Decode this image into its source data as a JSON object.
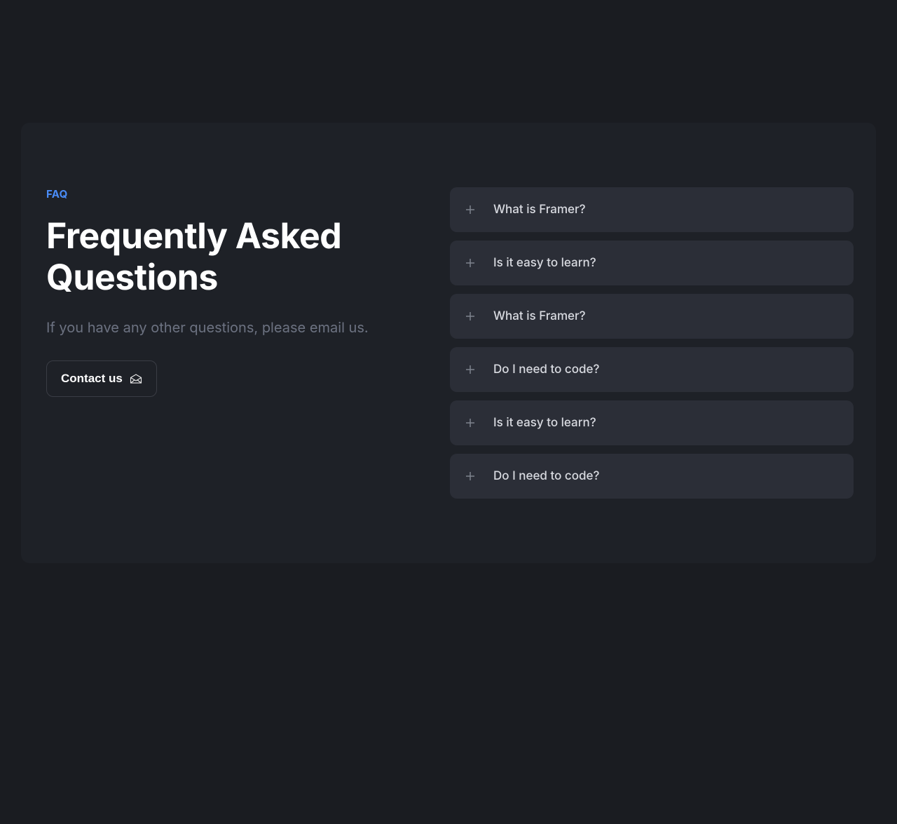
{
  "badge": "FAQ",
  "title": "Frequently Asked Questions",
  "subtitle": "If you have any other questions, please email us.",
  "contact_button": "Contact us",
  "faq_items": [
    {
      "question": "What is Framer?"
    },
    {
      "question": "Is it easy to learn?"
    },
    {
      "question": "What is Framer?"
    },
    {
      "question": "Do I need to code?"
    },
    {
      "question": "Is it easy to learn?"
    },
    {
      "question": "Do I need to code?"
    }
  ]
}
